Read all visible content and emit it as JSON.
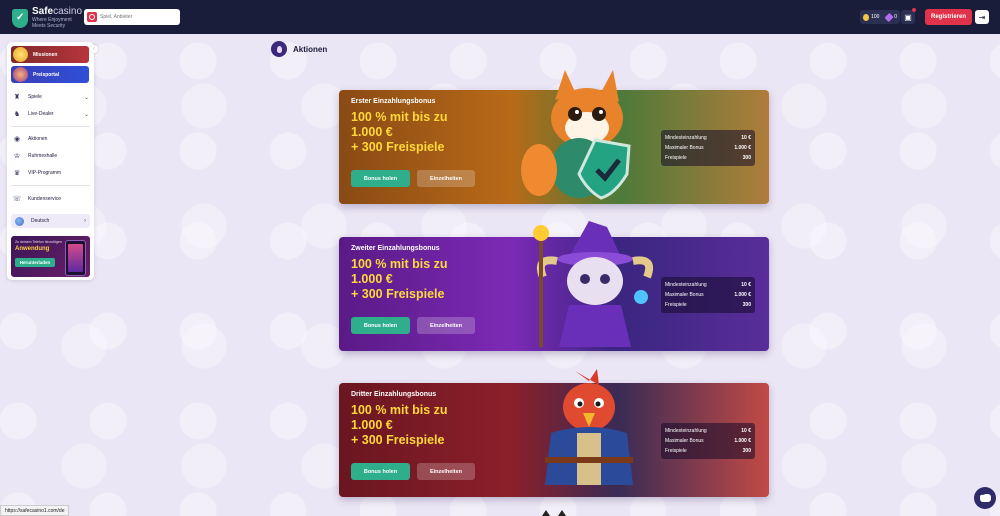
{
  "header": {
    "logo_name": "Safecasino",
    "logo_name_accent": "casino",
    "logo_name_main": "Safe",
    "logo_tagline_1": "Where Enjoyment",
    "logo_tagline_2": "Meets Security",
    "search_placeholder": "Spiel, Anbieter",
    "coins": "100",
    "gems": "0",
    "register_label": "Registrieren"
  },
  "sidebar": {
    "missions_label": "Missionen",
    "prize_label": "Preisportal",
    "nav": [
      {
        "label": "Spiele",
        "icon": "games-icon",
        "has_chevron": true
      },
      {
        "label": "Live-Dealer",
        "icon": "live-dealer-icon",
        "has_chevron": true
      },
      {
        "label": "Aktionen",
        "icon": "promotions-icon",
        "badge": "2"
      },
      {
        "label": "Ruhmeshalle",
        "icon": "hall-of-fame-icon"
      },
      {
        "label": "VIP-Programm",
        "icon": "vip-icon"
      },
      {
        "label": "Kundenservice",
        "icon": "support-icon"
      }
    ],
    "language": "Deutsch",
    "app_banner": {
      "small_text": "Zu deinem Telefon hinzufügen",
      "title": "Anwendung",
      "button": "Herunterladen"
    }
  },
  "page": {
    "title": "Aktionen"
  },
  "cards": [
    {
      "title": "Erster Einzahlungsbonus",
      "line1": "100 % mit bis zu",
      "line2": "1.000 €",
      "line3": "+ 300 Freispiele",
      "primary": "Bonus holen",
      "secondary": "Einzelheiten",
      "stats": [
        {
          "label": "Mindesteinzahlung",
          "value": "10 €"
        },
        {
          "label": "Maximaler Bonus",
          "value": "1.000 €"
        },
        {
          "label": "Freispiele",
          "value": "300"
        }
      ]
    },
    {
      "title": "Zweiter Einzahlungsbonus",
      "line1": "100 % mit bis zu",
      "line2": "1.000 €",
      "line3": "+ 300 Freispiele",
      "primary": "Bonus holen",
      "secondary": "Einzelheiten",
      "stats": [
        {
          "label": "Mindesteinzahlung",
          "value": "10 €"
        },
        {
          "label": "Maximaler Bonus",
          "value": "1.000 €"
        },
        {
          "label": "Freispiele",
          "value": "300"
        }
      ]
    },
    {
      "title": "Dritter Einzahlungsbonus",
      "line1": "100 % mit bis zu",
      "line2": "1.000 €",
      "line3": "+ 300 Freispiele",
      "primary": "Bonus holen",
      "secondary": "Einzelheiten",
      "stats": [
        {
          "label": "Mindesteinzahlung",
          "value": "10 €"
        },
        {
          "label": "Maximaler Bonus",
          "value": "1.000 €"
        },
        {
          "label": "Freispiele",
          "value": "300"
        }
      ]
    }
  ],
  "status_bar_url": "https://safecasino1.com/de",
  "colors": {
    "header_bg": "#191d3a",
    "accent_red": "#e0334b",
    "accent_green": "#2fae8c",
    "headline_yellow": "#ffd93a"
  }
}
